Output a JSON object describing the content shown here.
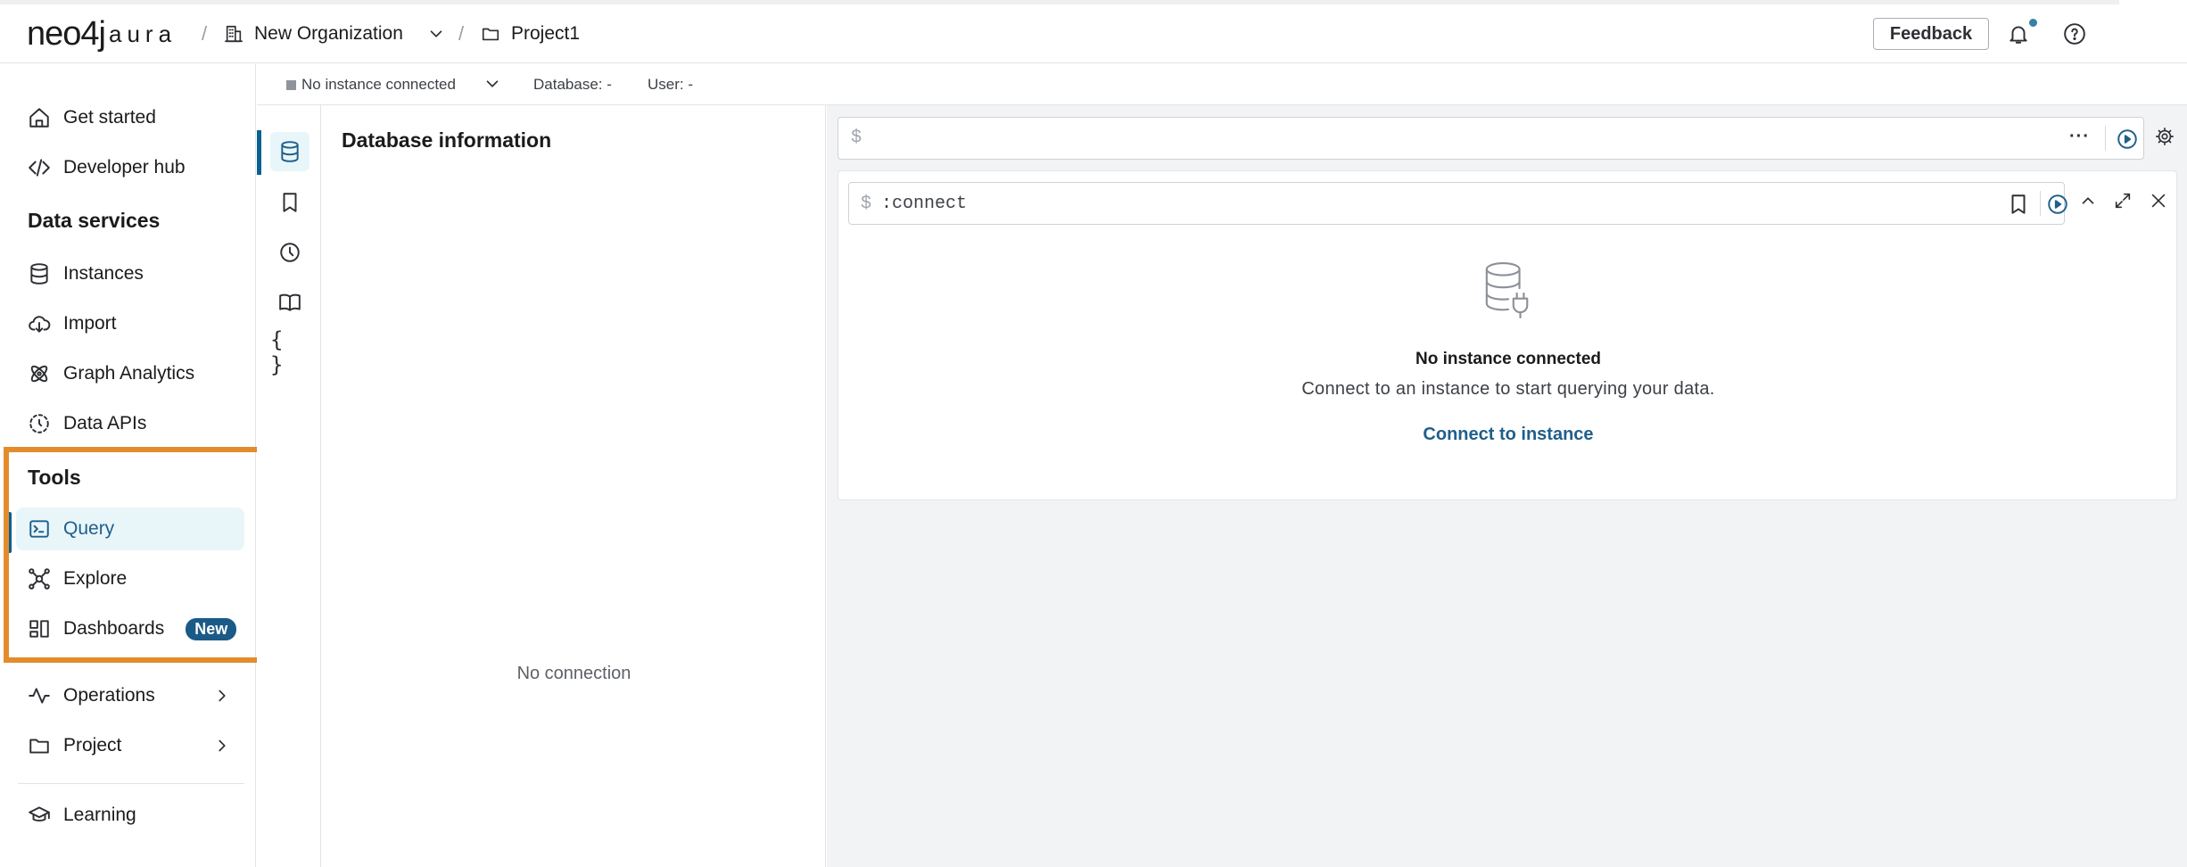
{
  "header": {
    "logo_main": "neo4j",
    "logo_sub": "aura",
    "separator": "/",
    "organization": "New Organization",
    "project": "Project1",
    "feedback_label": "Feedback"
  },
  "sidebar": {
    "top_items": [
      {
        "label": "Get started",
        "icon": "home-icon"
      },
      {
        "label": "Developer hub",
        "icon": "code-icon"
      }
    ],
    "data_services_title": "Data services",
    "data_services": [
      {
        "label": "Instances",
        "icon": "database-icon"
      },
      {
        "label": "Import",
        "icon": "cloud-download-icon"
      },
      {
        "label": "Graph Analytics",
        "icon": "graph-analytics-icon"
      },
      {
        "label": "Data APIs",
        "icon": "api-icon"
      }
    ],
    "tools_title": "Tools",
    "tools": [
      {
        "label": "Query",
        "icon": "terminal-icon",
        "active": true
      },
      {
        "label": "Explore",
        "icon": "explore-graph-icon"
      },
      {
        "label": "Dashboards",
        "icon": "dashboard-icon",
        "badge": "New"
      }
    ],
    "bottom_items": [
      {
        "label": "Operations",
        "icon": "activity-icon"
      },
      {
        "label": "Project",
        "icon": "folder-icon"
      }
    ],
    "learning": {
      "label": "Learning",
      "icon": "graduation-cap-icon"
    }
  },
  "connection_bar": {
    "status": "No instance connected",
    "database_label": "Database: -",
    "user_label": "User: -"
  },
  "rail": {
    "icons": [
      "database-icon",
      "bookmark-icon",
      "history-icon",
      "book-icon",
      "braces-icon"
    ],
    "braces_text": "{ }"
  },
  "db_panel": {
    "title": "Database information",
    "empty_text": "No connection"
  },
  "editor": {
    "prompt": "$",
    "more_label": "···"
  },
  "frame": {
    "prompt": "$",
    "command": ":connect",
    "empty_title": "No instance connected",
    "empty_text": "Connect to an instance to start querying your data.",
    "connect_link": "Connect to instance"
  },
  "colors": {
    "accent": "#1f5f8b",
    "active_bg": "#e8f6f9",
    "highlight_box": "#e38c2c",
    "badge_bg": "#1b5a87"
  }
}
